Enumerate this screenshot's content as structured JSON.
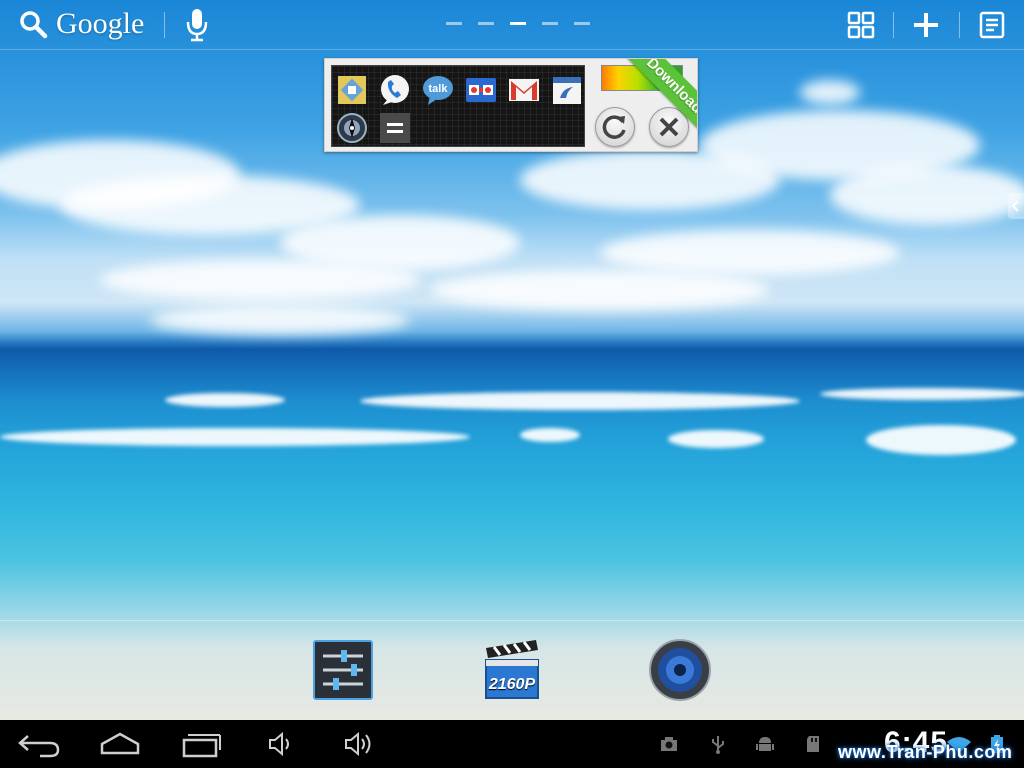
{
  "search_bar": {
    "brand_text": "Google",
    "icons": [
      "search-icon",
      "microphone-icon"
    ]
  },
  "home_pages": {
    "count": 5,
    "active_index": 3
  },
  "top_actions": [
    "all-apps-icon",
    "add-icon",
    "notes-icon"
  ],
  "widget": {
    "apps": [
      "photo-gallery-icon",
      "phone-icon",
      "google-talk-icon",
      "google-goggles-icon",
      "gmail-icon",
      "calendar-icon",
      "compass-icon",
      "calculator-icon"
    ],
    "ribbon_text": "Download",
    "actions": [
      "refresh-icon",
      "close-icon"
    ]
  },
  "dock": {
    "apps": [
      {
        "icon": "settings-icon",
        "label": ""
      },
      {
        "icon": "video-player-icon",
        "label": "2160P"
      },
      {
        "icon": "speaker-icon",
        "label": ""
      }
    ]
  },
  "nav_bar": {
    "buttons": [
      "back-icon",
      "home-icon",
      "recent-apps-icon",
      "volume-down-icon",
      "volume-up-icon"
    ]
  },
  "status_bar": {
    "icons": [
      "camera-icon",
      "usb-icon",
      "android-debug-icon",
      "sd-card-icon",
      "wifi-icon",
      "battery-charging-icon"
    ],
    "clock": "6:45",
    "watermark": "www.Tran-Phu.com"
  },
  "colors": {
    "ribbon_green": "#5cc23a",
    "nav_bar": "#000000",
    "sky_blue": "#1a86d6"
  }
}
